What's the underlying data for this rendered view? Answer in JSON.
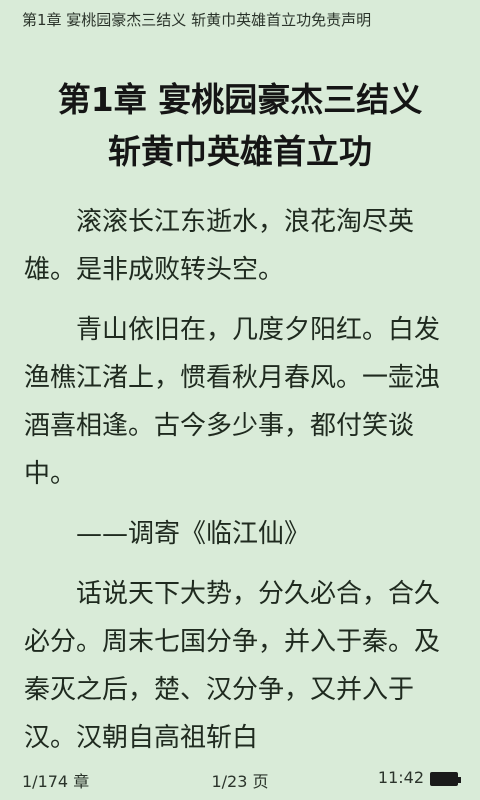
{
  "header": {
    "title": "第1章 宴桃园豪杰三结义 斩黄巾英雄首立功免责声明"
  },
  "chapter": {
    "title_line1": "第1章 宴桃园豪杰三结义",
    "title_line2": "斩黄巾英雄首立功"
  },
  "content": {
    "paragraphs": [
      "滚滚长江东逝水，浪花淘尽英雄。是非成败转头空。",
      "青山依旧在，几度夕阳红。白发渔樵江渚上，惯看秋月春风。一壶浊酒喜相逢。古今多少事，都付笑谈中。",
      "——调寄《临江仙》",
      "话说天下大势，分久必合，合久必分。周末七国分争，并入于秦。及秦灭之后，楚、汉分争，又并入于汉。汉朝自高祖斩白"
    ]
  },
  "footer": {
    "chapter_progress": "1/174 章",
    "page_progress": "1/23 页",
    "time": "11:42",
    "battery_icon": "battery-full-icon"
  },
  "colors": {
    "background": "#d9ebd8",
    "text": "#1f2a1f"
  }
}
